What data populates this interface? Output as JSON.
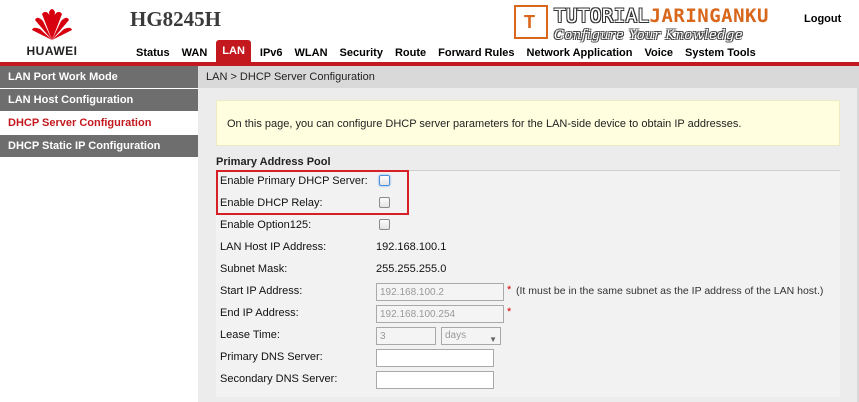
{
  "header": {
    "brand": "HUAWEI",
    "model": "HG8245H",
    "logout": "Logout",
    "watermark": {
      "line1_a": "TUTORIAL",
      "line1_b": "JARINGANKU",
      "line2": "Configure Your Knowledge",
      "box_letter": "T"
    },
    "nav": [
      "Status",
      "WAN",
      "LAN",
      "IPv6",
      "WLAN",
      "Security",
      "Route",
      "Forward Rules",
      "Network Application",
      "Voice",
      "System Tools"
    ],
    "active_nav": "LAN"
  },
  "sidebar": {
    "items": [
      "LAN Port Work Mode",
      "LAN Host Configuration",
      "DHCP Server Configuration",
      "DHCP Static IP Configuration"
    ],
    "active": "DHCP Server Configuration"
  },
  "main": {
    "breadcrumb": "LAN > DHCP Server Configuration",
    "info": "On this page, you can configure DHCP server parameters for the LAN-side device to obtain IP addresses.",
    "section_title": "Primary Address Pool",
    "fields": {
      "enable_primary": {
        "label": "Enable Primary DHCP Server:",
        "checked": false
      },
      "enable_relay": {
        "label": "Enable DHCP Relay:",
        "checked": false
      },
      "enable_option125": {
        "label": "Enable Option125:",
        "checked": false
      },
      "lan_host_ip": {
        "label": "LAN Host IP Address:",
        "value": "192.168.100.1"
      },
      "subnet_mask": {
        "label": "Subnet Mask:",
        "value": "255.255.255.0"
      },
      "start_ip": {
        "label": "Start IP Address:",
        "value": "192.168.100.2",
        "note": "(It must be in the same subnet as the IP address of the LAN host.)"
      },
      "end_ip": {
        "label": "End IP Address:",
        "value": "192.168.100.254"
      },
      "lease_time": {
        "label": "Lease Time:",
        "value": "3",
        "unit": "days"
      },
      "primary_dns": {
        "label": "Primary DNS Server:",
        "value": ""
      },
      "secondary_dns": {
        "label": "Secondary DNS Server:",
        "value": ""
      }
    },
    "required_mark": "*"
  },
  "colors": {
    "accent": "#c3191e",
    "sidebar_bg": "#6e6e6e",
    "info_bg": "#ffffe0",
    "highlight": "#d61f26"
  }
}
